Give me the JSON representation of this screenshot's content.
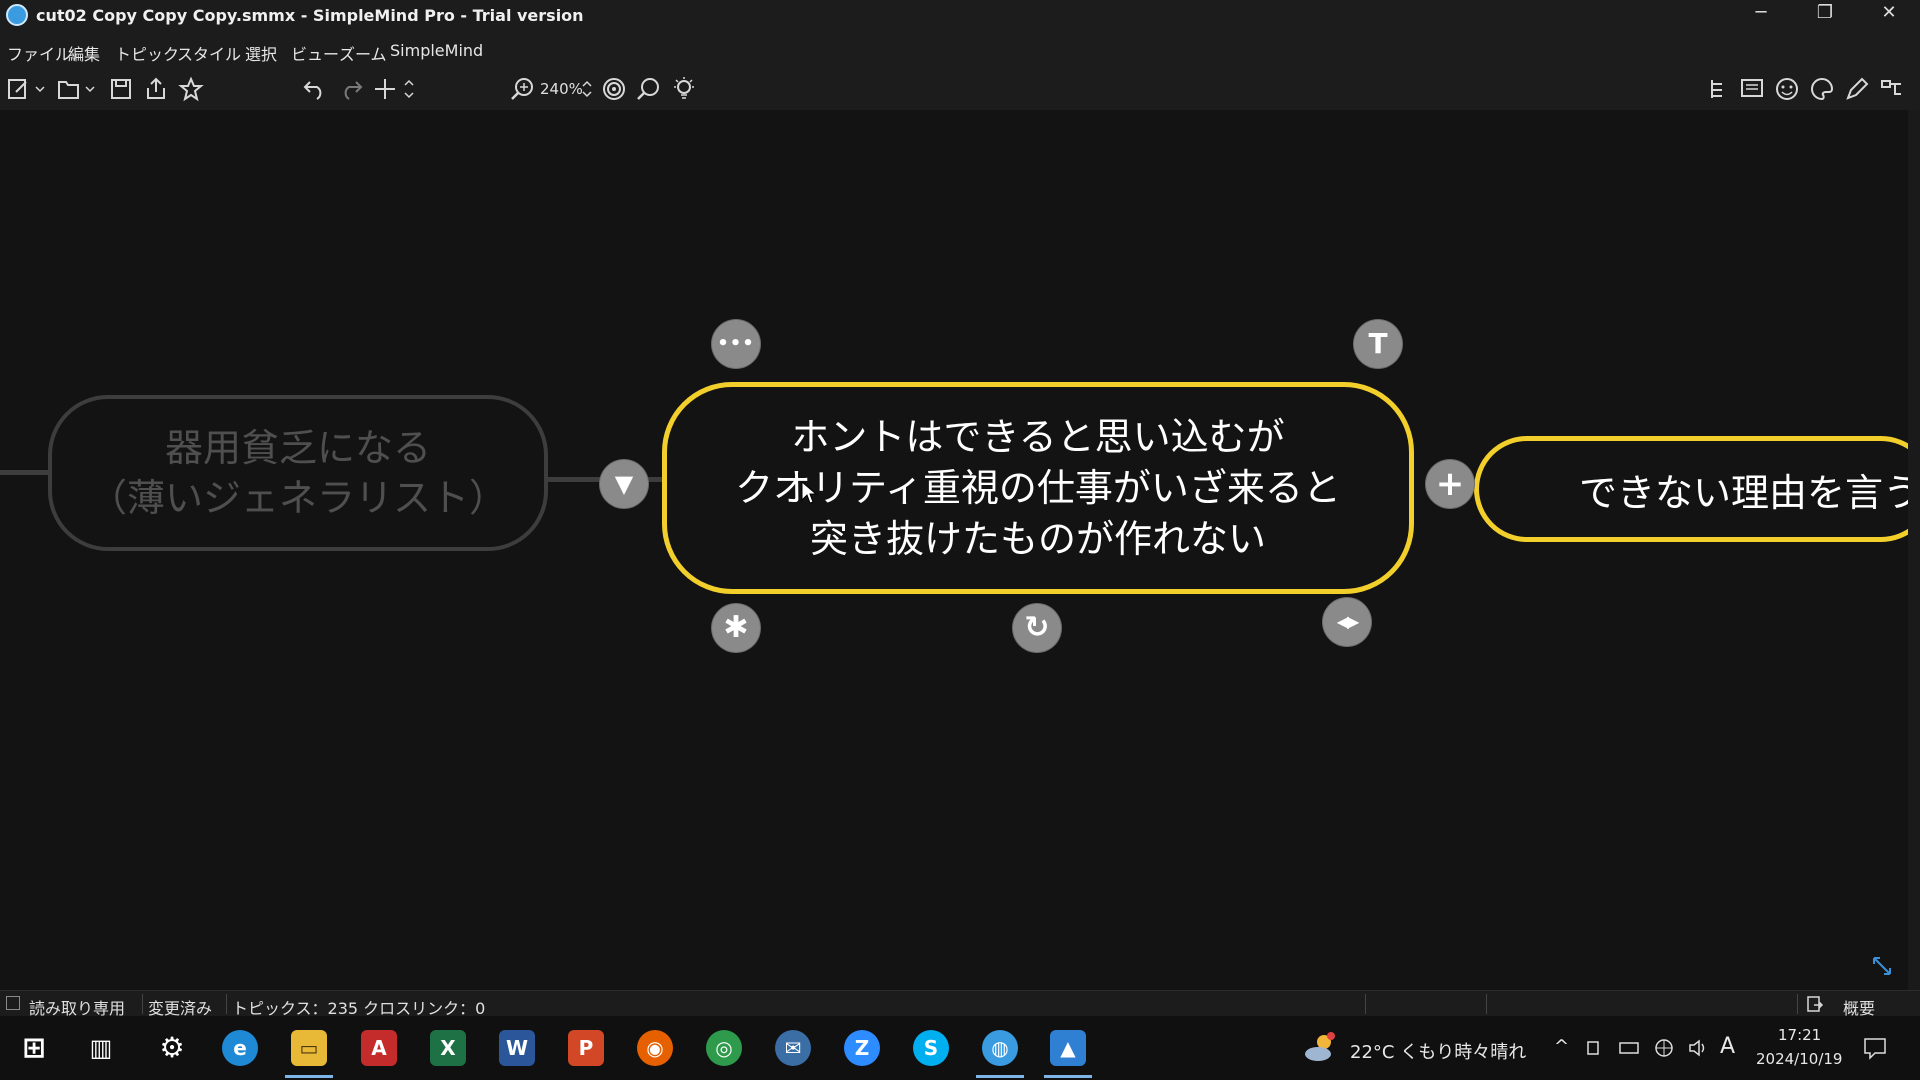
{
  "window": {
    "title": "cut02 Copy Copy Copy.smmx - SimpleMind Pro - Trial version",
    "minimize_glyph": "─",
    "restore_glyph": "❐",
    "close_glyph": "✕"
  },
  "menu": [
    "ファイル",
    "編集",
    "トピック",
    "スタイル",
    "選択",
    "ビュー",
    "ズーム",
    "SimpleMind"
  ],
  "toolbar": {
    "zoom_label": "240%",
    "icons": [
      "new-icon",
      "open-icon",
      "save-icon",
      "share-icon",
      "star-icon",
      "undo-icon",
      "redo-icon",
      "add-icon",
      "zoom-icon",
      "focus-icon",
      "search-icon",
      "bulb-icon",
      "outline-icon",
      "notes-icon",
      "emoji-icon",
      "palette-icon",
      "pen-icon",
      "layout-icon"
    ]
  },
  "mindmap": {
    "dim_node": {
      "line1": "器用貧乏になる",
      "line2": "（薄いジェネラリスト）"
    },
    "main_node": {
      "line1": "ホントはできると思い込むが",
      "line2": "クオリティ重視の仕事がいざ来ると",
      "line3": "突き抜けたものが作れない"
    },
    "right_node": {
      "text": "できない理由を言うの"
    },
    "handles": {
      "more": "•••",
      "text": "T",
      "add": "+",
      "collapse": "▼",
      "star": "✱",
      "rotate": "↻",
      "resize": "◀▶"
    }
  },
  "status": {
    "readonly_label": "読み取り専用",
    "modified_label": "変更済み",
    "topics_label": "トピックス：235 クロスリンク：0",
    "overview_label": "概要"
  },
  "taskbar": {
    "apps": [
      {
        "name": "start",
        "glyph": "⊞",
        "color": "#1c1c1c"
      },
      {
        "name": "task-view",
        "glyph": "▥",
        "color": "#1c1c1c"
      },
      {
        "name": "settings",
        "glyph": "⚙",
        "color": "#1c1c1c"
      },
      {
        "name": "edge",
        "glyph": "e",
        "color": "#1e8ad6"
      },
      {
        "name": "file-explorer",
        "glyph": "▭",
        "color": "#e8b837"
      },
      {
        "name": "acrobat",
        "glyph": "A",
        "color": "#c42b2b"
      },
      {
        "name": "excel",
        "glyph": "X",
        "color": "#1e7145"
      },
      {
        "name": "word",
        "glyph": "W",
        "color": "#2b579a"
      },
      {
        "name": "powerpoint",
        "glyph": "P",
        "color": "#d24726"
      },
      {
        "name": "firefox",
        "glyph": "◉",
        "color": "#e66000"
      },
      {
        "name": "chrome",
        "glyph": "◎",
        "color": "#2d9b4b"
      },
      {
        "name": "thunderbird",
        "glyph": "✉",
        "color": "#3a6ea5"
      },
      {
        "name": "zoom",
        "glyph": "Z",
        "color": "#2d8cff"
      },
      {
        "name": "skype",
        "glyph": "S",
        "color": "#00aff0"
      },
      {
        "name": "simplemind",
        "glyph": "◍",
        "color": "#3b9be0"
      },
      {
        "name": "photos",
        "glyph": "▲",
        "color": "#2f7fd3"
      }
    ],
    "weather": "22°C くもり時々晴れ",
    "time": "17:21",
    "date": "2024/10/19",
    "ime": "A"
  },
  "colors": {
    "accent": "#f2cf2b",
    "canvas": "#131313",
    "dim_border": "#3d3d3d"
  }
}
